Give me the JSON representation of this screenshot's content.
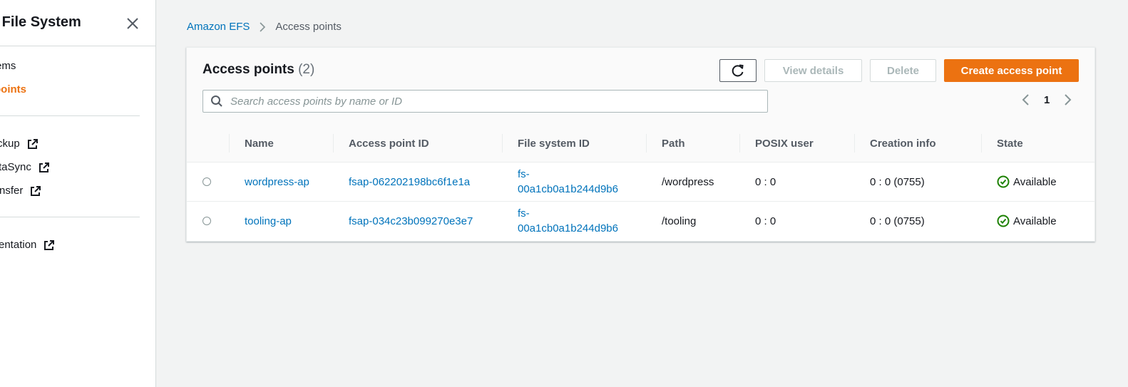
{
  "sidebar": {
    "title": "c File System",
    "items": [
      {
        "label": "ems",
        "active": false,
        "external": false
      },
      {
        "label": "points",
        "active": true,
        "external": false
      },
      {
        "label": "ckup",
        "active": false,
        "external": true
      },
      {
        "label": "taSync",
        "active": false,
        "external": true
      },
      {
        "label": "nsfer",
        "active": false,
        "external": true
      },
      {
        "label": "entation",
        "active": false,
        "external": true
      }
    ]
  },
  "breadcrumb": {
    "root": "Amazon EFS",
    "current": "Access points"
  },
  "panel": {
    "title": "Access points",
    "count": "(2)",
    "buttons": {
      "view_details": "View details",
      "delete": "Delete",
      "create": "Create access point"
    },
    "search_placeholder": "Search access points by name or ID",
    "page": "1"
  },
  "table": {
    "columns": [
      "Name",
      "Access point ID",
      "File system ID",
      "Path",
      "POSIX user",
      "Creation info",
      "State"
    ],
    "rows": [
      {
        "name": "wordpress-ap",
        "access_point_id": "fsap-062202198bc6f1e1a",
        "fs_id_line1": "fs-",
        "fs_id_line2": "00a1cb0a1b244d9b6",
        "path": "/wordpress",
        "posix_user": "0 : 0",
        "creation_info": "0 : 0 (0755)",
        "state": "Available"
      },
      {
        "name": "tooling-ap",
        "access_point_id": "fsap-034c23b099270e3e7",
        "fs_id_line1": "fs-",
        "fs_id_line2": "00a1cb0a1b244d9b6",
        "path": "/tooling",
        "posix_user": "0 : 0",
        "creation_info": "0 : 0 (0755)",
        "state": "Available"
      }
    ]
  },
  "colors": {
    "accent": "#ec7211",
    "link": "#0073bb",
    "success": "#1d8102"
  }
}
